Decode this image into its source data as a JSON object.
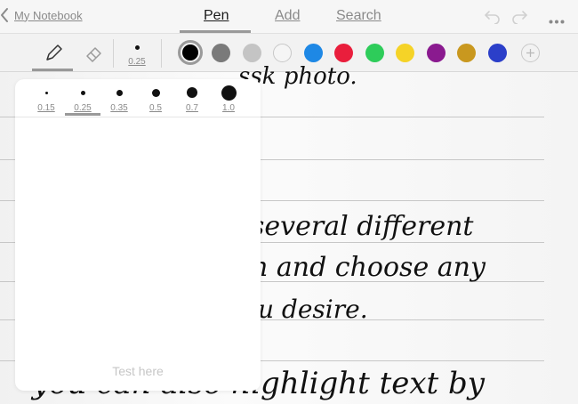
{
  "nav": {
    "back_label": "My Notebook",
    "tabs": [
      {
        "label": "Pen",
        "active": true
      },
      {
        "label": "Add",
        "active": false
      },
      {
        "label": "Search",
        "active": false
      }
    ],
    "icons": [
      "undo-icon",
      "redo-icon",
      "more-icon"
    ]
  },
  "toolbar": {
    "tools": [
      "pen-icon",
      "eraser-icon"
    ],
    "selected_tool": "pen",
    "size_label": "0.25",
    "colors": [
      "#000000",
      "#7a7a7a",
      "#c4c4c4",
      "#f5f5f5",
      "#1e88e5",
      "#e91e3c",
      "#2ecc5a",
      "#f5d327",
      "#8a1a8f",
      "#c9981f",
      "#2b3fc9"
    ],
    "selected_color": "#000000"
  },
  "size_popover": {
    "options": [
      "0.15",
      "0.25",
      "0.35",
      "0.5",
      "0.7",
      "1.0"
    ],
    "selected": "0.25",
    "test_placeholder": "Test here"
  },
  "notebook": {
    "lines": [
      "ssk photo.",
      "several different",
      "n and choose any",
      "u desire.",
      "you can also highlight text by"
    ]
  }
}
